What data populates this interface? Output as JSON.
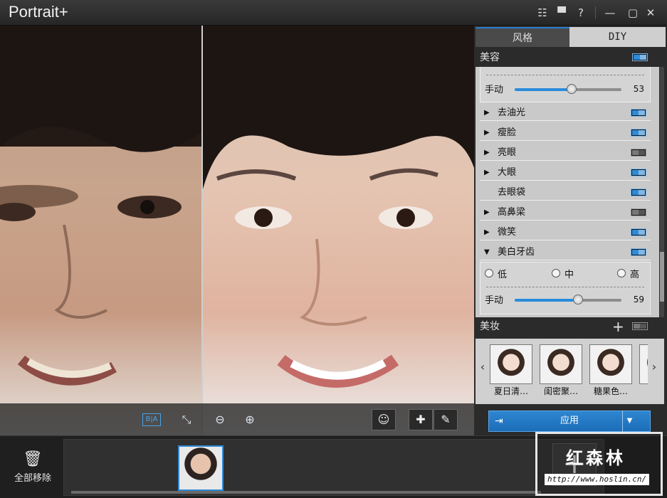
{
  "window": {
    "title": "Portrait+"
  },
  "titlebar": {
    "menu_icon": "☷",
    "feedback_icon": "▀",
    "help": "?",
    "minimize": "—",
    "maximize": "▢",
    "close": "✕"
  },
  "viewer": {
    "toolbar": {
      "before_after": "B|A",
      "fit": "⤡",
      "zoom_out": "⊖",
      "zoom_in": "⊕",
      "smile": "☺",
      "heal": "✚",
      "brush": "✎"
    }
  },
  "panel": {
    "tabs": [
      {
        "label": "风格"
      },
      {
        "label": "DIY"
      }
    ],
    "beauty": {
      "title": "美容"
    },
    "skin": {
      "slider_label": "手动",
      "slider_value": "53",
      "slider_fraction": 0.53
    },
    "items": [
      {
        "label": "去油光",
        "on": true,
        "expandable": true
      },
      {
        "label": "瘦脸",
        "on": true,
        "expandable": true
      },
      {
        "label": "亮眼",
        "on": false,
        "expandable": true
      },
      {
        "label": "大眼",
        "on": true,
        "expandable": true
      },
      {
        "label": "去眼袋",
        "on": true,
        "expandable": false
      },
      {
        "label": "高鼻梁",
        "on": false,
        "expandable": true
      },
      {
        "label": "微笑",
        "on": true,
        "expandable": true
      },
      {
        "label": "美白牙齿",
        "on": true,
        "expandable": true,
        "expanded": true
      }
    ],
    "teeth": {
      "options": [
        "低",
        "中",
        "高"
      ],
      "slider_label": "手动",
      "slider_value": "59",
      "slider_fraction": 0.59
    },
    "makeup": {
      "title": "美妆",
      "add": "+",
      "items": [
        "夏日清…",
        "闺密聚…",
        "糖果色…"
      ]
    },
    "apply": {
      "label": "应用"
    }
  },
  "bottom": {
    "remove_all": "全部移除",
    "add": "+"
  },
  "watermark": {
    "logo": "红森林",
    "url": "http://www.hoslin.cn/"
  }
}
